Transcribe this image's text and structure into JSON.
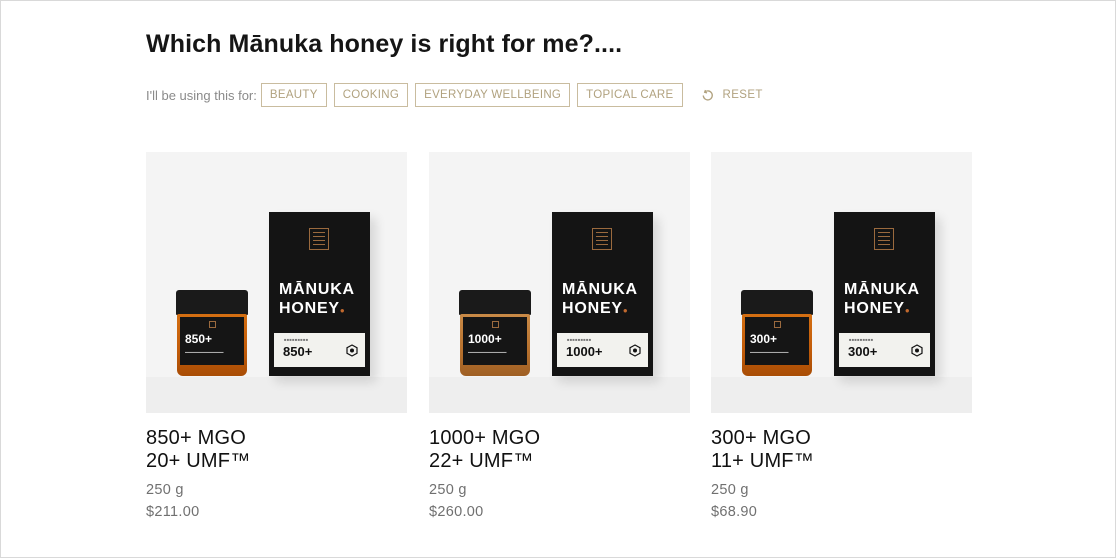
{
  "page": {
    "title": "Which Mānuka honey is right for me?...."
  },
  "filters": {
    "label": "I'll be using this for:",
    "chips": [
      "BEAUTY",
      "COOKING",
      "EVERYDAY WELLBEING",
      "TOPICAL CARE"
    ],
    "reset_label": "RESET",
    "reset_icon": "reset-icon"
  },
  "colors": {
    "accent": "#b1a27f",
    "chip_border": "#c9bc9f",
    "box": "#141414",
    "honey": "#c35d0a"
  },
  "products": [
    {
      "box_title": "MĀNUKA HONEY",
      "grade": "850+",
      "mgo": "850+ MGO",
      "umf": "20+ UMF™",
      "size": "250 g",
      "price": "$211.00"
    },
    {
      "box_title": "MĀNUKA HONEY",
      "grade": "1000+",
      "mgo": "1000+ MGO",
      "umf": "22+ UMF™",
      "size": "250 g",
      "price": "$260.00"
    },
    {
      "box_title": "MĀNUKA HONEY",
      "grade": "300+",
      "mgo": "300+ MGO",
      "umf": "11+ UMF™",
      "size": "250 g",
      "price": "$68.90"
    }
  ]
}
